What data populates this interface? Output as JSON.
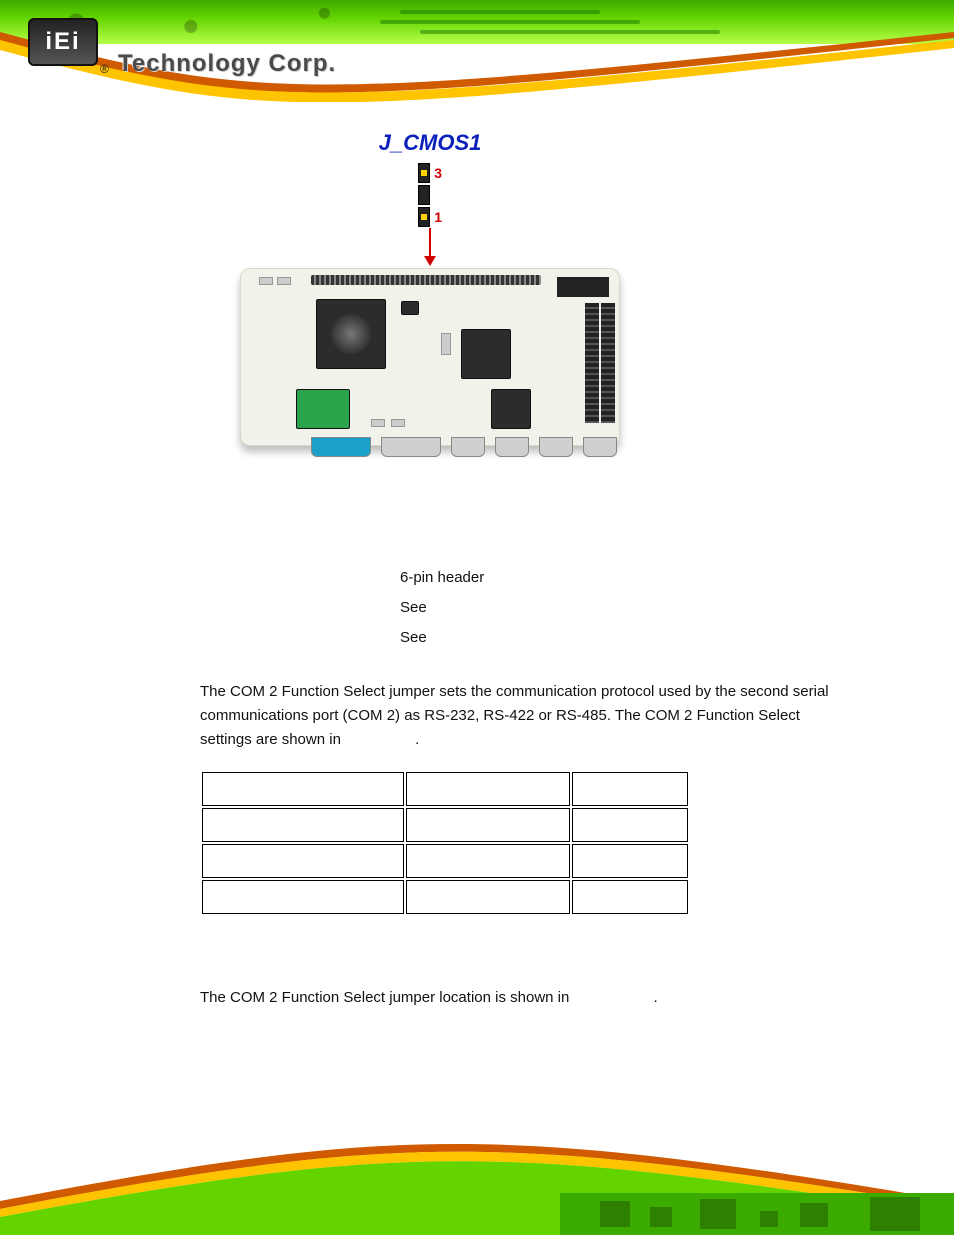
{
  "brand": {
    "logo_text": "iEi",
    "registered": "®",
    "name": "Technology Corp."
  },
  "figure": {
    "callout_label": "J_CMOS1",
    "pin_labels": {
      "top": "3",
      "bottom": "1"
    }
  },
  "spec": {
    "type_value": "6-pin header",
    "location_value": "See",
    "settings_value": "See"
  },
  "paragraph1": "The COM 2 Function Select jumper sets the communication protocol used by the second serial communications port (COM 2) as RS-232, RS-422 or RS-485. The COM 2 Function Select settings are shown in",
  "paragraph1_tail": ".",
  "paragraph2": "The COM 2 Function Select jumper location is shown in",
  "paragraph2_tail": ".",
  "table": {
    "rows": 4,
    "cols": 3
  }
}
